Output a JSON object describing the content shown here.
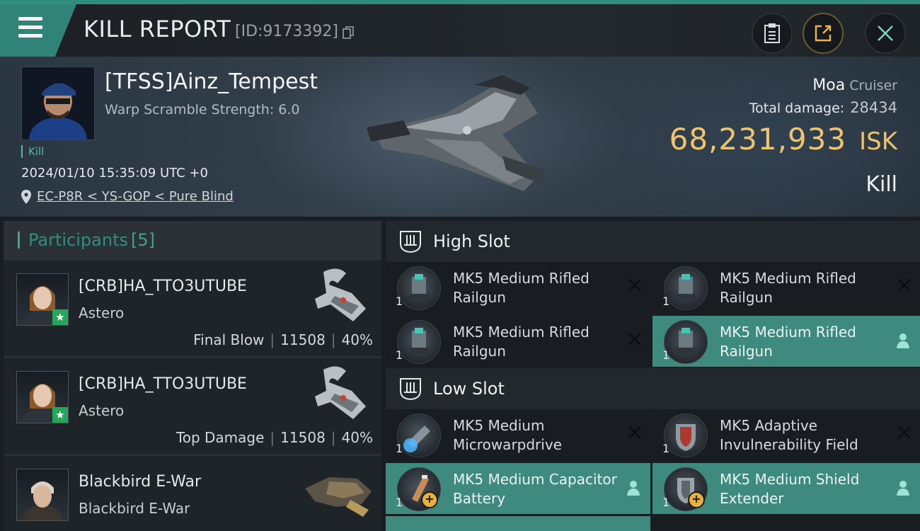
{
  "header": {
    "title": "KILL REPORT",
    "report_id": "[ID:9173392]",
    "icons": [
      "menu-icon",
      "copy-icon",
      "clipboard-icon",
      "share-icon",
      "close-icon"
    ]
  },
  "victim": {
    "name": "[TFSS]Ainz_Tempest",
    "warp_scramble": "Warp Scramble Strength: 6.0",
    "kill_tag": "Kill",
    "datetime": "2024/01/10 15:35:09 UTC +0",
    "location": "EC-P8R < YS-GOP < Pure Blind",
    "ship_name": "Moa",
    "ship_class": "Cruiser",
    "total_damage_label": "Total damage:",
    "total_damage": "28434",
    "isk_value": "68,231,933",
    "isk_unit": "ISK",
    "result": "Kill"
  },
  "participants": {
    "label": "Participants",
    "count": "[5]",
    "rows": [
      {
        "name": "[CRB]HA_TTO3UTUBE",
        "ship": "Astero",
        "role": "Final Blow",
        "damage": "11508",
        "percent": "40%"
      },
      {
        "name": "[CRB]HA_TTO3UTUBE",
        "ship": "Astero",
        "role": "Top Damage",
        "damage": "11508",
        "percent": "40%"
      },
      {
        "name": "Blackbird E-War",
        "ship": "Blackbird E-War"
      }
    ]
  },
  "high_slot": {
    "title": "High Slot",
    "items": [
      {
        "qty": "1",
        "name": "MK5 Medium Rifled Railgun",
        "state": "destroyed"
      },
      {
        "qty": "1",
        "name": "MK5 Medium Rifled Railgun",
        "state": "destroyed"
      },
      {
        "qty": "1",
        "name": "MK5 Medium Rifled Railgun",
        "state": "destroyed"
      },
      {
        "qty": "1",
        "name": "MK5 Medium Rifled Railgun",
        "state": "dropped"
      }
    ]
  },
  "low_slot": {
    "title": "Low Slot",
    "items": [
      {
        "qty": "1",
        "name": "MK5 Medium Microwarpdrive",
        "state": "destroyed"
      },
      {
        "qty": "1",
        "name": "MK5 Adaptive Invulnerability Field",
        "state": "destroyed"
      },
      {
        "qty": "1",
        "name": "MK5 Medium Capacitor Battery",
        "state": "dropped"
      },
      {
        "qty": "1",
        "name": "MK5 Medium Shield Extender",
        "state": "dropped"
      }
    ]
  },
  "colors": {
    "accent_teal": "#3f8a7f",
    "isk_gold": "#f0c46a",
    "final_blow_star": "#26a65b"
  }
}
